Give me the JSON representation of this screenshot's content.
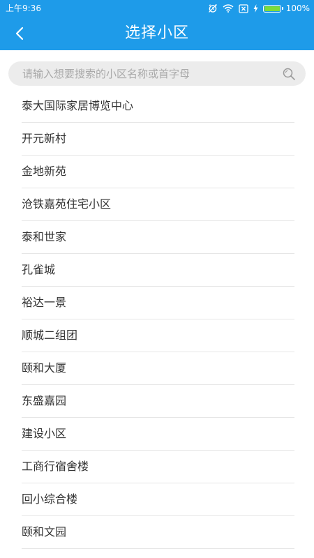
{
  "status_bar": {
    "time": "上午9:36",
    "battery_level": 1.0,
    "battery_percent": "100%",
    "icons": [
      "alarm-icon",
      "wifi-icon",
      "no-sim-icon",
      "charging-icon",
      "battery-icon"
    ]
  },
  "header": {
    "back_icon": "chevron-left-icon",
    "title": "选择小区"
  },
  "search": {
    "placeholder": "请输入想要搜索的小区名称或首字母",
    "value": "",
    "icon": "search-icon"
  },
  "communities": [
    "泰大国际家居博览中心",
    "开元新村",
    "金地新苑",
    "沧铁嘉苑住宅小区",
    "泰和世家",
    "孔雀城",
    "裕达一景",
    "顺城二组团",
    "颐和大厦",
    "东盛嘉园",
    "建设小区",
    "工商行宿舍楼",
    "回小综合楼",
    "颐和文园"
  ],
  "colors": {
    "primary": "#1e9be9",
    "search_bg": "#ececec",
    "text": "#333333",
    "divider": "#e6e6e6",
    "battery_fill": "#7ddc3a"
  }
}
